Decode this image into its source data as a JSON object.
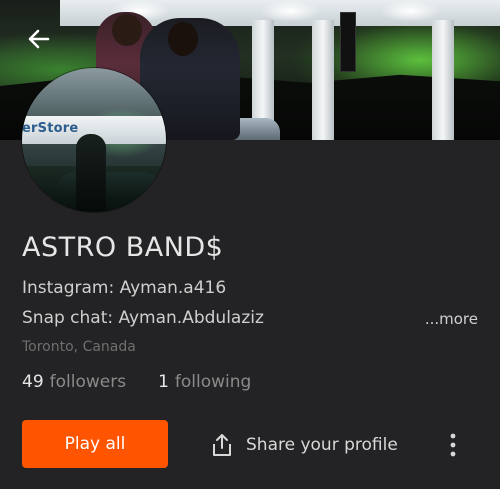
{
  "header": {
    "back_icon": "arrow-left-icon",
    "banner_image": "header-banner-photo"
  },
  "avatar": {
    "image": "profile-avatar-photo",
    "visible_sign_text": "erStore"
  },
  "profile": {
    "name": "ASTRO BAND$",
    "bio_lines": [
      "Instagram: Ayman.a416",
      "Snap chat: Ayman.Abdulaziz"
    ],
    "more_label": "...more",
    "location": "Toronto, Canada"
  },
  "stats": {
    "followers_count": "49",
    "followers_label": "followers",
    "following_count": "1",
    "following_label": "following"
  },
  "actions": {
    "play_all_label": "Play all",
    "share_label": "Share your profile",
    "share_icon": "share-icon",
    "overflow_icon": "more-vertical-icon"
  },
  "colors": {
    "background": "#232224",
    "accent": "#ff5500",
    "text_primary": "#e6e6e6",
    "text_secondary": "#8a8a8a",
    "text_muted": "#6f6f6f"
  }
}
